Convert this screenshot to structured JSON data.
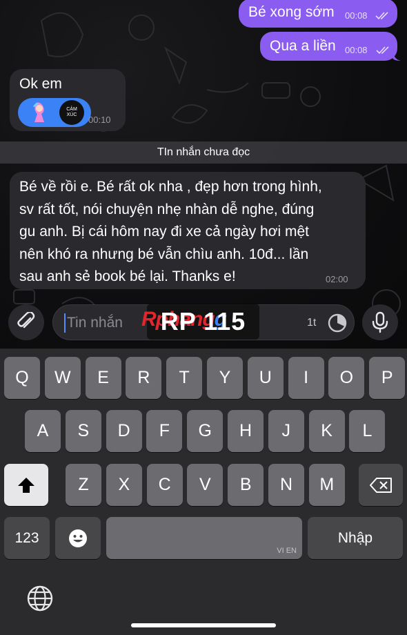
{
  "messages_out": [
    {
      "text": "Bé xong sớm",
      "time": "00:08",
      "status": "read"
    },
    {
      "text": "Qua a liền",
      "time": "00:08",
      "status": "read"
    }
  ],
  "message_in_1": {
    "text": "Ok em",
    "sticker_caption": "CẢM XÚC",
    "time": "00:10"
  },
  "unread_divider": "TIn nhắn chưa đọc",
  "message_in_2": {
    "lines": [
      "Bé về rồi e. Bé rất ok nha , đẹp hơn trong hình,",
      "sv rất tốt, nói chuyện nhẹ nhàn dễ nghe, đúng",
      "gu anh. Bị cái hôm nay đi xe cả ngày hơi mệt",
      "nên khó ra nhưng bé vẫn chìu anh. 10đ... lần",
      "sau anh sẻ book bé lại. Thanks e!"
    ],
    "time": "02:00"
  },
  "input": {
    "placeholder": "Tin nhắn",
    "timer_label": "1t"
  },
  "watermark": {
    "brand": "Rphang",
    "brand_suffix": "g",
    "overlay": "RP 115"
  },
  "keyboard": {
    "row1": [
      "Q",
      "W",
      "E",
      "R",
      "T",
      "Y",
      "U",
      "I",
      "O",
      "P"
    ],
    "row2": [
      "A",
      "S",
      "D",
      "F",
      "G",
      "H",
      "J",
      "K",
      "L"
    ],
    "row3": [
      "Z",
      "X",
      "C",
      "V",
      "B",
      "N",
      "M"
    ],
    "numbers_key": "123",
    "return_key": "Nhập",
    "space_hint": "VI EN"
  },
  "colors": {
    "accent": "#8b5cf0",
    "bubble_in": "#2a2a2e",
    "keyboard_bg": "#2b2b2d",
    "key": "#6c6c70",
    "watermark_red": "#e2262e"
  },
  "icons": [
    "attach-icon",
    "microphone-icon",
    "timer-icon",
    "shift-icon",
    "backspace-icon",
    "emoji-icon",
    "globe-icon",
    "double-check-icon"
  ]
}
